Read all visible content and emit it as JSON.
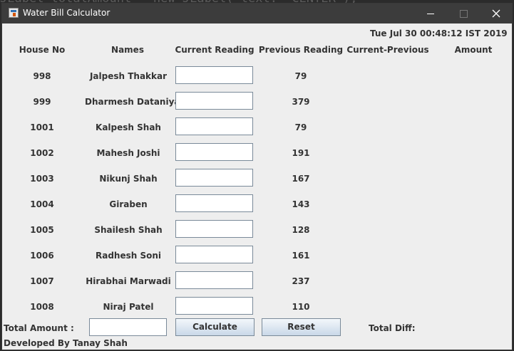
{
  "background_code_text": "JLabel totalAmount = new JLabel( text: \"CENTER\");",
  "window": {
    "title": "Water Bill Calculator"
  },
  "timestamp": "Tue Jul 30 00:48:12 IST 2019",
  "headers": {
    "house_no": "House No",
    "names": "Names",
    "current_reading": "Current Reading",
    "previous_reading": "Previous Reading",
    "current_minus_previous": "Current-Previous",
    "amount": "Amount"
  },
  "rows": [
    {
      "house": "998",
      "name": "Jalpesh Thakkar",
      "current": "",
      "previous": "79"
    },
    {
      "house": "999",
      "name": "Dharmesh Dataniya",
      "current": "",
      "previous": "379"
    },
    {
      "house": "1001",
      "name": "Kalpesh Shah",
      "current": "",
      "previous": "79"
    },
    {
      "house": "1002",
      "name": "Mahesh Joshi",
      "current": "",
      "previous": "191"
    },
    {
      "house": "1003",
      "name": "Nikunj Shah",
      "current": "",
      "previous": "167"
    },
    {
      "house": "1004",
      "name": "Giraben",
      "current": "",
      "previous": "143"
    },
    {
      "house": "1005",
      "name": "Shailesh Shah",
      "current": "",
      "previous": "128"
    },
    {
      "house": "1006",
      "name": "Radhesh Soni",
      "current": "",
      "previous": "161"
    },
    {
      "house": "1007",
      "name": "Hirabhai Marwadi",
      "current": "",
      "previous": "237"
    },
    {
      "house": "1008",
      "name": "Niraj Patel",
      "current": "",
      "previous": "110"
    }
  ],
  "footer": {
    "total_amount_label": "Total Amount :",
    "total_amount_value": "",
    "calculate_label": "Calculate",
    "reset_label": "Reset",
    "total_diff_label": "Total Diff:",
    "developer_credit": "Developed By Tanay Shah"
  }
}
